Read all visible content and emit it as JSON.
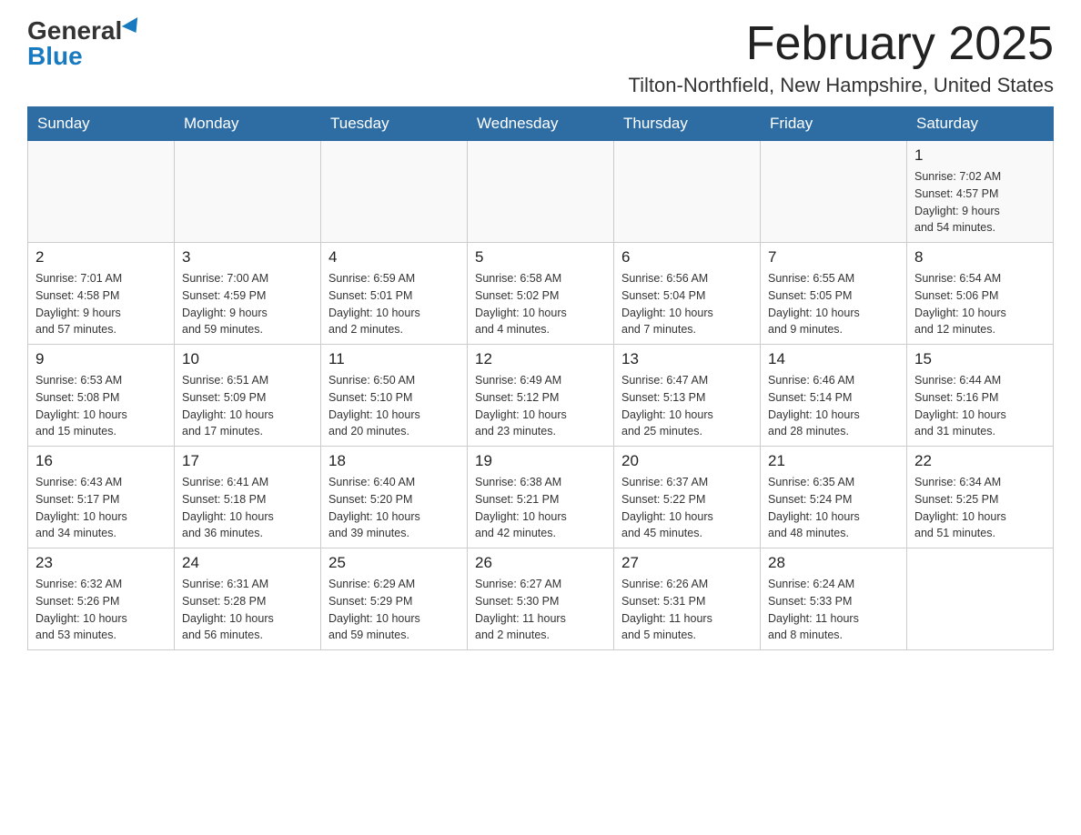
{
  "logo": {
    "general": "General",
    "blue": "Blue"
  },
  "title": "February 2025",
  "location": "Tilton-Northfield, New Hampshire, United States",
  "days_of_week": [
    "Sunday",
    "Monday",
    "Tuesday",
    "Wednesday",
    "Thursday",
    "Friday",
    "Saturday"
  ],
  "weeks": [
    [
      {
        "day": "",
        "info": ""
      },
      {
        "day": "",
        "info": ""
      },
      {
        "day": "",
        "info": ""
      },
      {
        "day": "",
        "info": ""
      },
      {
        "day": "",
        "info": ""
      },
      {
        "day": "",
        "info": ""
      },
      {
        "day": "1",
        "info": "Sunrise: 7:02 AM\nSunset: 4:57 PM\nDaylight: 9 hours\nand 54 minutes."
      }
    ],
    [
      {
        "day": "2",
        "info": "Sunrise: 7:01 AM\nSunset: 4:58 PM\nDaylight: 9 hours\nand 57 minutes."
      },
      {
        "day": "3",
        "info": "Sunrise: 7:00 AM\nSunset: 4:59 PM\nDaylight: 9 hours\nand 59 minutes."
      },
      {
        "day": "4",
        "info": "Sunrise: 6:59 AM\nSunset: 5:01 PM\nDaylight: 10 hours\nand 2 minutes."
      },
      {
        "day": "5",
        "info": "Sunrise: 6:58 AM\nSunset: 5:02 PM\nDaylight: 10 hours\nand 4 minutes."
      },
      {
        "day": "6",
        "info": "Sunrise: 6:56 AM\nSunset: 5:04 PM\nDaylight: 10 hours\nand 7 minutes."
      },
      {
        "day": "7",
        "info": "Sunrise: 6:55 AM\nSunset: 5:05 PM\nDaylight: 10 hours\nand 9 minutes."
      },
      {
        "day": "8",
        "info": "Sunrise: 6:54 AM\nSunset: 5:06 PM\nDaylight: 10 hours\nand 12 minutes."
      }
    ],
    [
      {
        "day": "9",
        "info": "Sunrise: 6:53 AM\nSunset: 5:08 PM\nDaylight: 10 hours\nand 15 minutes."
      },
      {
        "day": "10",
        "info": "Sunrise: 6:51 AM\nSunset: 5:09 PM\nDaylight: 10 hours\nand 17 minutes."
      },
      {
        "day": "11",
        "info": "Sunrise: 6:50 AM\nSunset: 5:10 PM\nDaylight: 10 hours\nand 20 minutes."
      },
      {
        "day": "12",
        "info": "Sunrise: 6:49 AM\nSunset: 5:12 PM\nDaylight: 10 hours\nand 23 minutes."
      },
      {
        "day": "13",
        "info": "Sunrise: 6:47 AM\nSunset: 5:13 PM\nDaylight: 10 hours\nand 25 minutes."
      },
      {
        "day": "14",
        "info": "Sunrise: 6:46 AM\nSunset: 5:14 PM\nDaylight: 10 hours\nand 28 minutes."
      },
      {
        "day": "15",
        "info": "Sunrise: 6:44 AM\nSunset: 5:16 PM\nDaylight: 10 hours\nand 31 minutes."
      }
    ],
    [
      {
        "day": "16",
        "info": "Sunrise: 6:43 AM\nSunset: 5:17 PM\nDaylight: 10 hours\nand 34 minutes."
      },
      {
        "day": "17",
        "info": "Sunrise: 6:41 AM\nSunset: 5:18 PM\nDaylight: 10 hours\nand 36 minutes."
      },
      {
        "day": "18",
        "info": "Sunrise: 6:40 AM\nSunset: 5:20 PM\nDaylight: 10 hours\nand 39 minutes."
      },
      {
        "day": "19",
        "info": "Sunrise: 6:38 AM\nSunset: 5:21 PM\nDaylight: 10 hours\nand 42 minutes."
      },
      {
        "day": "20",
        "info": "Sunrise: 6:37 AM\nSunset: 5:22 PM\nDaylight: 10 hours\nand 45 minutes."
      },
      {
        "day": "21",
        "info": "Sunrise: 6:35 AM\nSunset: 5:24 PM\nDaylight: 10 hours\nand 48 minutes."
      },
      {
        "day": "22",
        "info": "Sunrise: 6:34 AM\nSunset: 5:25 PM\nDaylight: 10 hours\nand 51 minutes."
      }
    ],
    [
      {
        "day": "23",
        "info": "Sunrise: 6:32 AM\nSunset: 5:26 PM\nDaylight: 10 hours\nand 53 minutes."
      },
      {
        "day": "24",
        "info": "Sunrise: 6:31 AM\nSunset: 5:28 PM\nDaylight: 10 hours\nand 56 minutes."
      },
      {
        "day": "25",
        "info": "Sunrise: 6:29 AM\nSunset: 5:29 PM\nDaylight: 10 hours\nand 59 minutes."
      },
      {
        "day": "26",
        "info": "Sunrise: 6:27 AM\nSunset: 5:30 PM\nDaylight: 11 hours\nand 2 minutes."
      },
      {
        "day": "27",
        "info": "Sunrise: 6:26 AM\nSunset: 5:31 PM\nDaylight: 11 hours\nand 5 minutes."
      },
      {
        "day": "28",
        "info": "Sunrise: 6:24 AM\nSunset: 5:33 PM\nDaylight: 11 hours\nand 8 minutes."
      },
      {
        "day": "",
        "info": ""
      }
    ]
  ]
}
